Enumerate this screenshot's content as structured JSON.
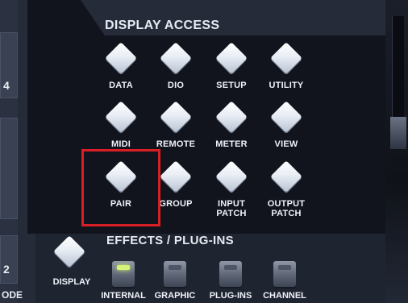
{
  "side": {
    "digit_1": "4",
    "digit_2": "2",
    "word": "ODE"
  },
  "display_access": {
    "title": "DISPLAY ACCESS",
    "buttons": [
      {
        "label": "DATA"
      },
      {
        "label": "DIO"
      },
      {
        "label": "SETUP"
      },
      {
        "label": "UTILITY"
      },
      {
        "label": "MIDI"
      },
      {
        "label": "REMOTE"
      },
      {
        "label": "METER"
      },
      {
        "label": "VIEW"
      },
      {
        "label": "PAIR",
        "highlighted": true
      },
      {
        "label": "GROUP"
      },
      {
        "label": "INPUT\nPATCH"
      },
      {
        "label": "OUTPUT\nPATCH"
      }
    ]
  },
  "effects": {
    "title": "EFFECTS / PLUG-INS",
    "display_label": "DISPLAY",
    "buttons": [
      {
        "label": "INTERNAL",
        "led_on": true
      },
      {
        "label": "GRAPHIC",
        "led_on": false
      },
      {
        "label": "PLUG-INS",
        "led_on": false
      },
      {
        "label": "CHANNEL",
        "led_on": false
      }
    ]
  },
  "colors": {
    "highlight": "#d91e26",
    "led_on": "#d7f27a",
    "panel": "#11141d"
  }
}
